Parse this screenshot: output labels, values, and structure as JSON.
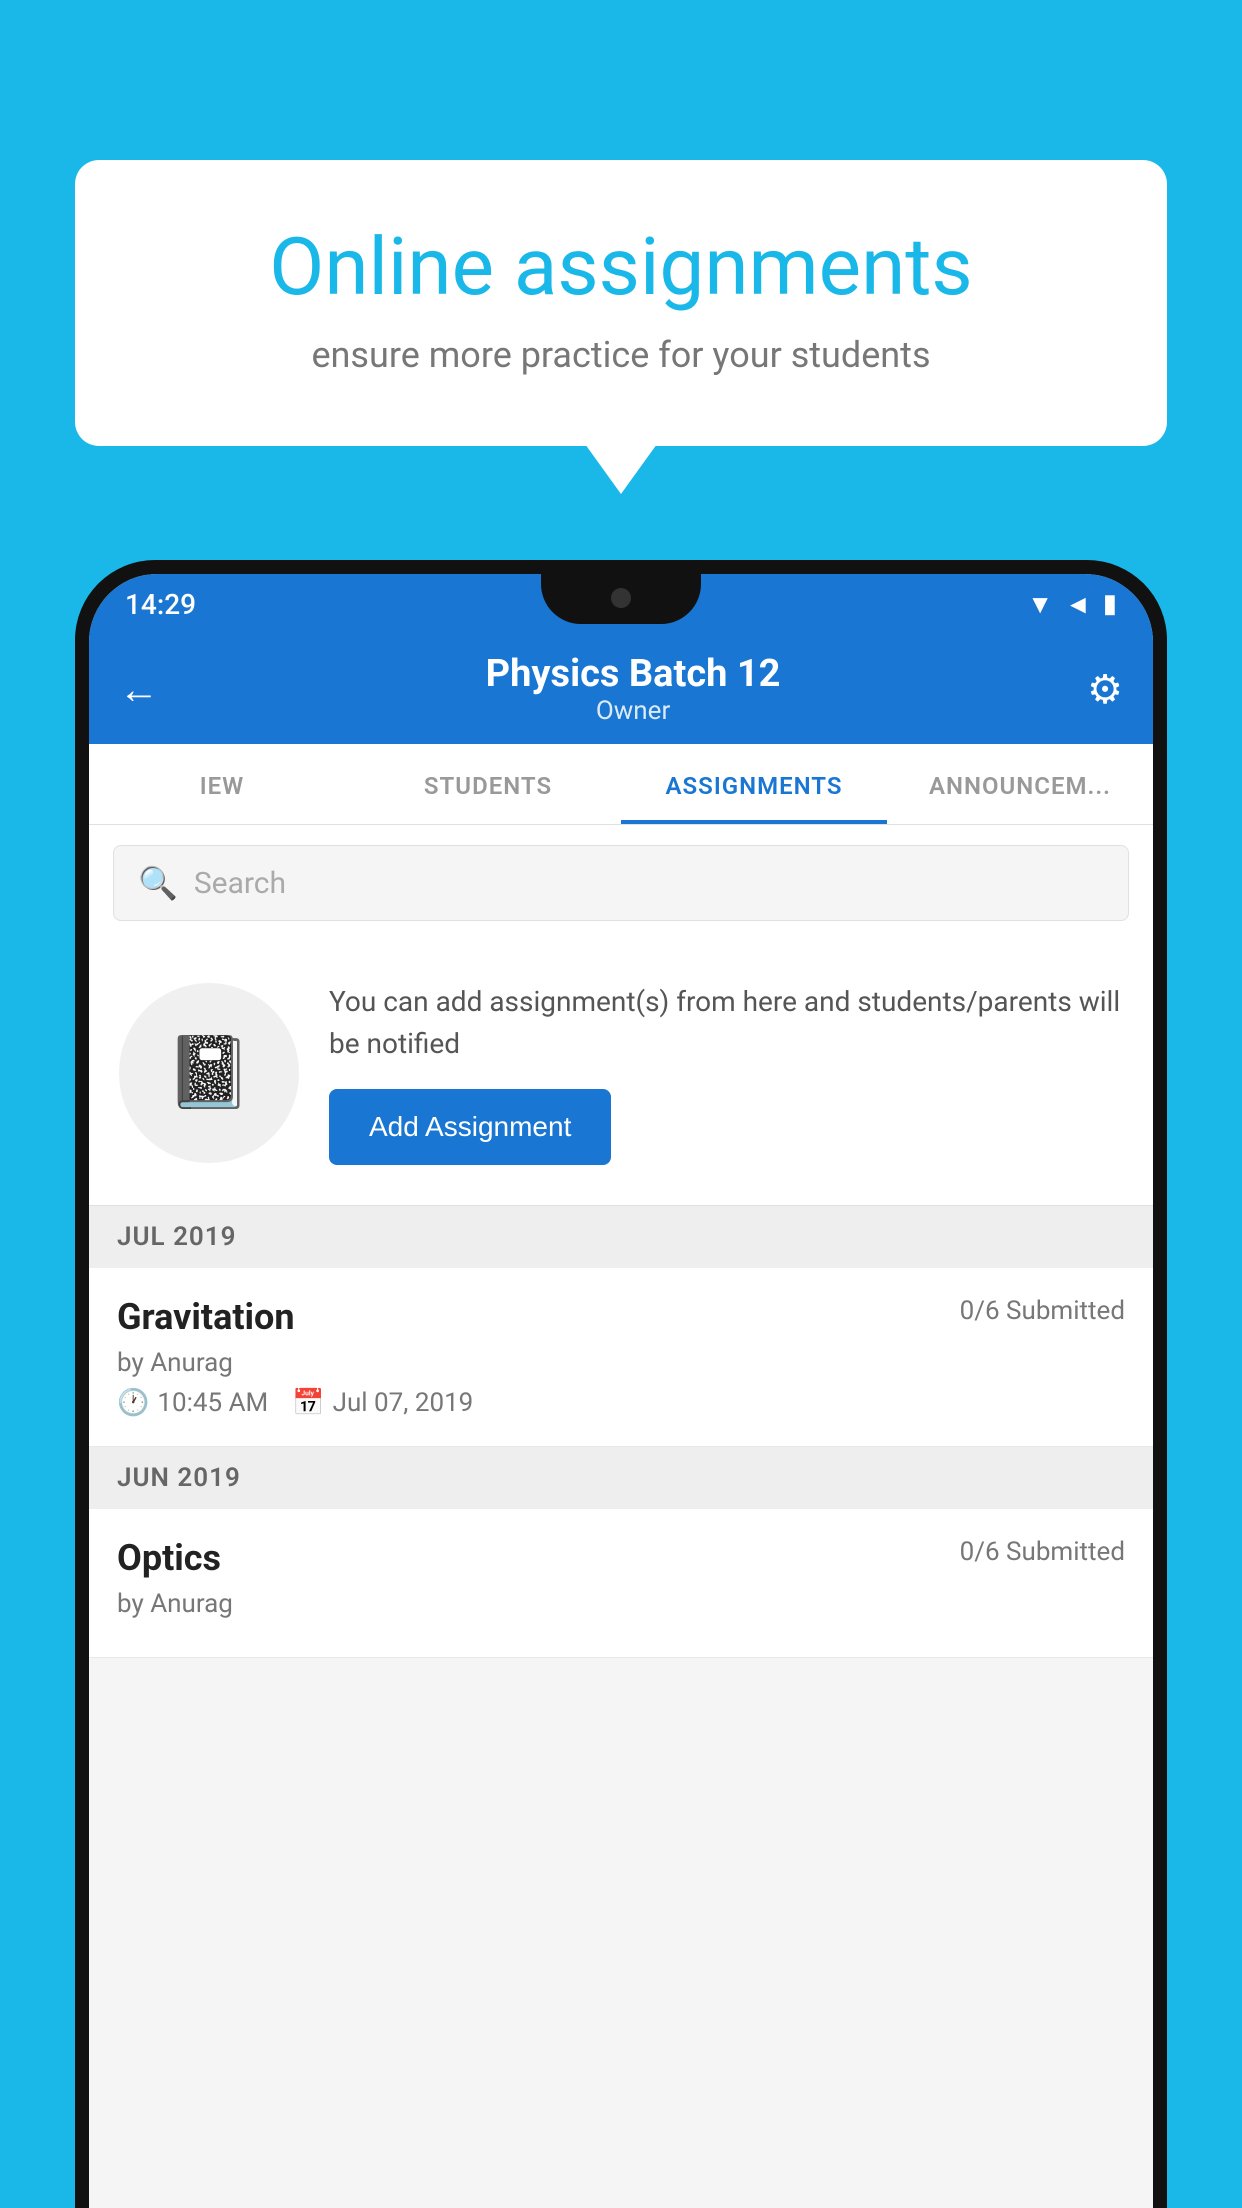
{
  "background_color": "#1ab8e8",
  "speech_bubble": {
    "title": "Online assignments",
    "subtitle": "ensure more practice for your students"
  },
  "status_bar": {
    "time": "14:29",
    "wifi_icon": "▼",
    "signal_icon": "◄",
    "battery_icon": "▮"
  },
  "app_bar": {
    "title": "Physics Batch 12",
    "subtitle": "Owner",
    "back_icon": "←",
    "settings_icon": "⚙"
  },
  "tabs": [
    {
      "id": "view",
      "label": "IEW",
      "active": false
    },
    {
      "id": "students",
      "label": "STUDENTS",
      "active": false
    },
    {
      "id": "assignments",
      "label": "ASSIGNMENTS",
      "active": true
    },
    {
      "id": "announcements",
      "label": "ANNOUNCEM...",
      "active": false
    }
  ],
  "search": {
    "placeholder": "Search"
  },
  "promo_card": {
    "text": "You can add assignment(s) from here and students/parents will be notified",
    "button_label": "Add Assignment"
  },
  "sections": [
    {
      "month_label": "JUL 2019",
      "assignments": [
        {
          "title": "Gravitation",
          "submitted": "0/6 Submitted",
          "by": "by Anurag",
          "time": "10:45 AM",
          "date": "Jul 07, 2019"
        }
      ]
    },
    {
      "month_label": "JUN 2019",
      "assignments": [
        {
          "title": "Optics",
          "submitted": "0/6 Submitted",
          "by": "by Anurag",
          "time": "",
          "date": ""
        }
      ]
    }
  ]
}
